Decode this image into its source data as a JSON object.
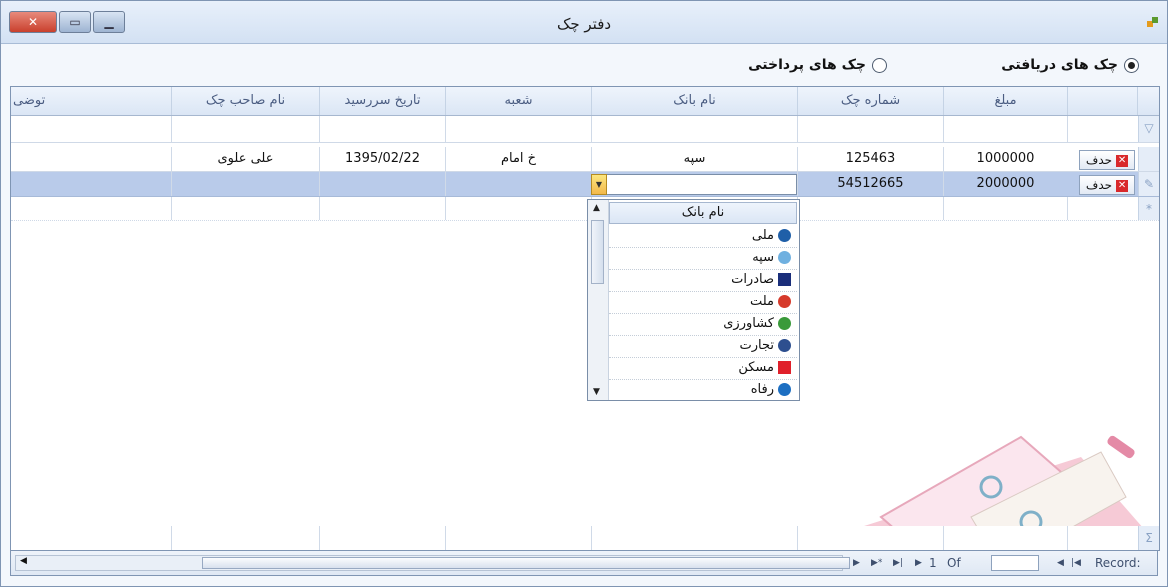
{
  "window": {
    "title": "دفتر چک",
    "close": "✕",
    "max": "▭",
    "min": "▁"
  },
  "radios": {
    "received": {
      "label": "چک های دریافتی",
      "checked": true
    },
    "paid": {
      "label": "چک های پرداختی",
      "checked": false
    }
  },
  "columns": {
    "amount": "مبلغ",
    "check_no": "شماره چک",
    "bank": "نام بانک",
    "branch": "شعبه",
    "due_date": "تاریخ سررسید",
    "owner": "نام صاحب چک",
    "desc": "توضی"
  },
  "rows": [
    {
      "delete": "حدف",
      "amount": "1000000",
      "check_no": "125463",
      "bank": "سپه",
      "branch": "خ امام",
      "due_date": "1395/02/22",
      "owner": "علی علوی"
    },
    {
      "delete": "حدف",
      "amount": "2000000",
      "check_no": "54512665",
      "bank": "",
      "branch": "",
      "due_date": "",
      "owner": ""
    }
  ],
  "bank_dropdown": {
    "header": "نام بانک",
    "items": [
      {
        "name": "ملی",
        "icon": "melli-bank-icon",
        "color": "#1f5fa8"
      },
      {
        "name": "سپه",
        "icon": "sepah-bank-icon",
        "color": "#6fb0e0"
      },
      {
        "name": "صادرات",
        "icon": "saderat-bank-icon",
        "color": "#1a2e7a"
      },
      {
        "name": "ملت",
        "icon": "mellat-bank-icon",
        "color": "#d63a2b"
      },
      {
        "name": "کشاورزی",
        "icon": "keshavarzi-bank-icon",
        "color": "#3a9a3a"
      },
      {
        "name": "تجارت",
        "icon": "tejarat-bank-icon",
        "color": "#2d4f8f"
      },
      {
        "name": "مسکن",
        "icon": "maskan-bank-icon",
        "color": "#e0202b"
      },
      {
        "name": "رفاه",
        "icon": "refah-bank-icon",
        "color": "#1d6fc2"
      }
    ]
  },
  "navigator": {
    "record_label": "Record:",
    "of_label": "Of",
    "count": "1"
  },
  "gutter": {
    "edit_marker": "✎",
    "new_marker": "*",
    "filter_icon": "▽",
    "sum_icon": "Σ"
  }
}
